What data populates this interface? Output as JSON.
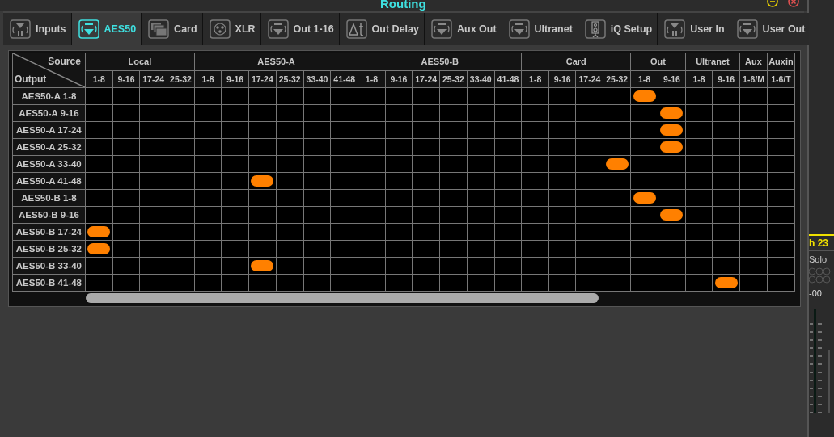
{
  "window": {
    "title": "Routing"
  },
  "tabs": [
    {
      "label": "Inputs",
      "kind": "in",
      "selected": false
    },
    {
      "label": "AES50",
      "kind": "out",
      "selected": true
    },
    {
      "label": "Card",
      "kind": "card",
      "selected": false
    },
    {
      "label": "XLR",
      "kind": "xlr",
      "selected": false
    },
    {
      "label": "Out 1-16",
      "kind": "out",
      "selected": false
    },
    {
      "label": "Out Delay",
      "kind": "delay",
      "selected": false
    },
    {
      "label": "Aux Out",
      "kind": "out",
      "selected": false
    },
    {
      "label": "Ultranet",
      "kind": "out",
      "selected": false
    },
    {
      "label": "iQ Setup",
      "kind": "speaker",
      "selected": false
    },
    {
      "label": "User In",
      "kind": "in",
      "selected": false
    },
    {
      "label": "User Out",
      "kind": "out",
      "selected": false
    }
  ],
  "matrix": {
    "source_label": "Source",
    "output_label": "Output",
    "groups": [
      {
        "label": "Local",
        "columns": [
          "1-8",
          "9-16",
          "17-24",
          "25-32"
        ]
      },
      {
        "label": "AES50-A",
        "columns": [
          "1-8",
          "9-16",
          "17-24",
          "25-32",
          "33-40",
          "41-48"
        ]
      },
      {
        "label": "AES50-B",
        "columns": [
          "1-8",
          "9-16",
          "17-24",
          "25-32",
          "33-40",
          "41-48"
        ]
      },
      {
        "label": "Card",
        "columns": [
          "1-8",
          "9-16",
          "17-24",
          "25-32"
        ]
      },
      {
        "label": "Out",
        "columns": [
          "1-8",
          "9-16"
        ]
      },
      {
        "label": "Ultranet",
        "columns": [
          "1-8",
          "9-16"
        ]
      },
      {
        "label": "Aux",
        "columns": [
          "1-6/M"
        ]
      },
      {
        "label": "Auxin",
        "columns": [
          "1-6/T"
        ]
      }
    ],
    "rows": [
      {
        "label": "AES50-A 1-8",
        "cells": [
          false,
          false,
          false,
          false,
          false,
          false,
          false,
          false,
          false,
          false,
          false,
          false,
          false,
          false,
          false,
          false,
          false,
          false,
          false,
          false,
          true,
          false,
          false,
          false,
          false,
          false
        ]
      },
      {
        "label": "AES50-A 9-16",
        "cells": [
          false,
          false,
          false,
          false,
          false,
          false,
          false,
          false,
          false,
          false,
          false,
          false,
          false,
          false,
          false,
          false,
          false,
          false,
          false,
          false,
          false,
          true,
          false,
          false,
          false,
          false
        ]
      },
      {
        "label": "AES50-A 17-24",
        "cells": [
          false,
          false,
          false,
          false,
          false,
          false,
          false,
          false,
          false,
          false,
          false,
          false,
          false,
          false,
          false,
          false,
          false,
          false,
          false,
          false,
          false,
          true,
          false,
          false,
          false,
          false
        ]
      },
      {
        "label": "AES50-A 25-32",
        "cells": [
          false,
          false,
          false,
          false,
          false,
          false,
          false,
          false,
          false,
          false,
          false,
          false,
          false,
          false,
          false,
          false,
          false,
          false,
          false,
          false,
          false,
          true,
          false,
          false,
          false,
          false
        ]
      },
      {
        "label": "AES50-A 33-40",
        "cells": [
          false,
          false,
          false,
          false,
          false,
          false,
          false,
          false,
          false,
          false,
          false,
          false,
          false,
          false,
          false,
          false,
          false,
          false,
          false,
          true,
          false,
          false,
          false,
          false,
          false,
          false
        ]
      },
      {
        "label": "AES50-A 41-48",
        "cells": [
          false,
          false,
          false,
          false,
          false,
          false,
          true,
          false,
          false,
          false,
          false,
          false,
          false,
          false,
          false,
          false,
          false,
          false,
          false,
          false,
          false,
          false,
          false,
          false,
          false,
          false
        ]
      },
      {
        "label": "AES50-B 1-8",
        "cells": [
          false,
          false,
          false,
          false,
          false,
          false,
          false,
          false,
          false,
          false,
          false,
          false,
          false,
          false,
          false,
          false,
          false,
          false,
          false,
          false,
          true,
          false,
          false,
          false,
          false,
          false
        ]
      },
      {
        "label": "AES50-B 9-16",
        "cells": [
          false,
          false,
          false,
          false,
          false,
          false,
          false,
          false,
          false,
          false,
          false,
          false,
          false,
          false,
          false,
          false,
          false,
          false,
          false,
          false,
          false,
          true,
          false,
          false,
          false,
          false
        ]
      },
      {
        "label": "AES50-B 17-24",
        "cells": [
          true,
          false,
          false,
          false,
          false,
          false,
          false,
          false,
          false,
          false,
          false,
          false,
          false,
          false,
          false,
          false,
          false,
          false,
          false,
          false,
          false,
          false,
          false,
          false,
          false,
          false
        ]
      },
      {
        "label": "AES50-B 25-32",
        "cells": [
          true,
          false,
          false,
          false,
          false,
          false,
          false,
          false,
          false,
          false,
          false,
          false,
          false,
          false,
          false,
          false,
          false,
          false,
          false,
          false,
          false,
          false,
          false,
          false,
          false,
          false
        ]
      },
      {
        "label": "AES50-B 33-40",
        "cells": [
          false,
          false,
          false,
          false,
          false,
          false,
          true,
          false,
          false,
          false,
          false,
          false,
          false,
          false,
          false,
          false,
          false,
          false,
          false,
          false,
          false,
          false,
          false,
          false,
          false,
          false
        ]
      },
      {
        "label": "AES50-B 41-48",
        "cells": [
          false,
          false,
          false,
          false,
          false,
          false,
          false,
          false,
          false,
          false,
          false,
          false,
          false,
          false,
          false,
          false,
          false,
          false,
          false,
          false,
          false,
          false,
          false,
          true,
          false,
          false
        ]
      }
    ]
  },
  "background_channel": {
    "name": "h 23",
    "solo": "Solo",
    "gain": "-00"
  }
}
